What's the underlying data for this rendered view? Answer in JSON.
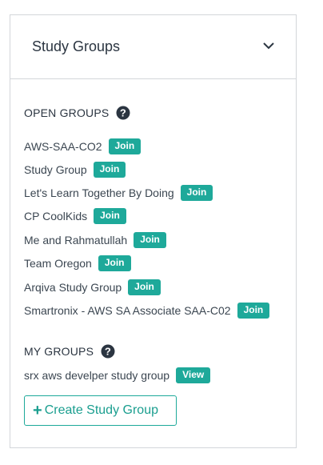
{
  "panel": {
    "title": "Study Groups"
  },
  "open_groups": {
    "heading": "OPEN GROUPS",
    "items": [
      {
        "name": "AWS-SAA-CO2",
        "action": "Join"
      },
      {
        "name": "Study Group",
        "action": "Join"
      },
      {
        "name": "Let's Learn Together By Doing",
        "action": "Join"
      },
      {
        "name": "CP CoolKids",
        "action": "Join"
      },
      {
        "name": "Me and Rahmatullah",
        "action": "Join"
      },
      {
        "name": "Team Oregon",
        "action": "Join"
      },
      {
        "name": "Arqiva Study Group",
        "action": "Join"
      },
      {
        "name": "Smartronix - AWS SA Associate SAA-C02",
        "action": "Join"
      }
    ]
  },
  "my_groups": {
    "heading": "MY GROUPS",
    "items": [
      {
        "name": "srx aws develper study group",
        "action": "View"
      }
    ]
  },
  "create_button": {
    "icon": "plus-icon",
    "label": "Create Study Group"
  },
  "colors": {
    "accent": "#1ea99a",
    "text": "#2b3541",
    "border": "#d3d6da"
  }
}
